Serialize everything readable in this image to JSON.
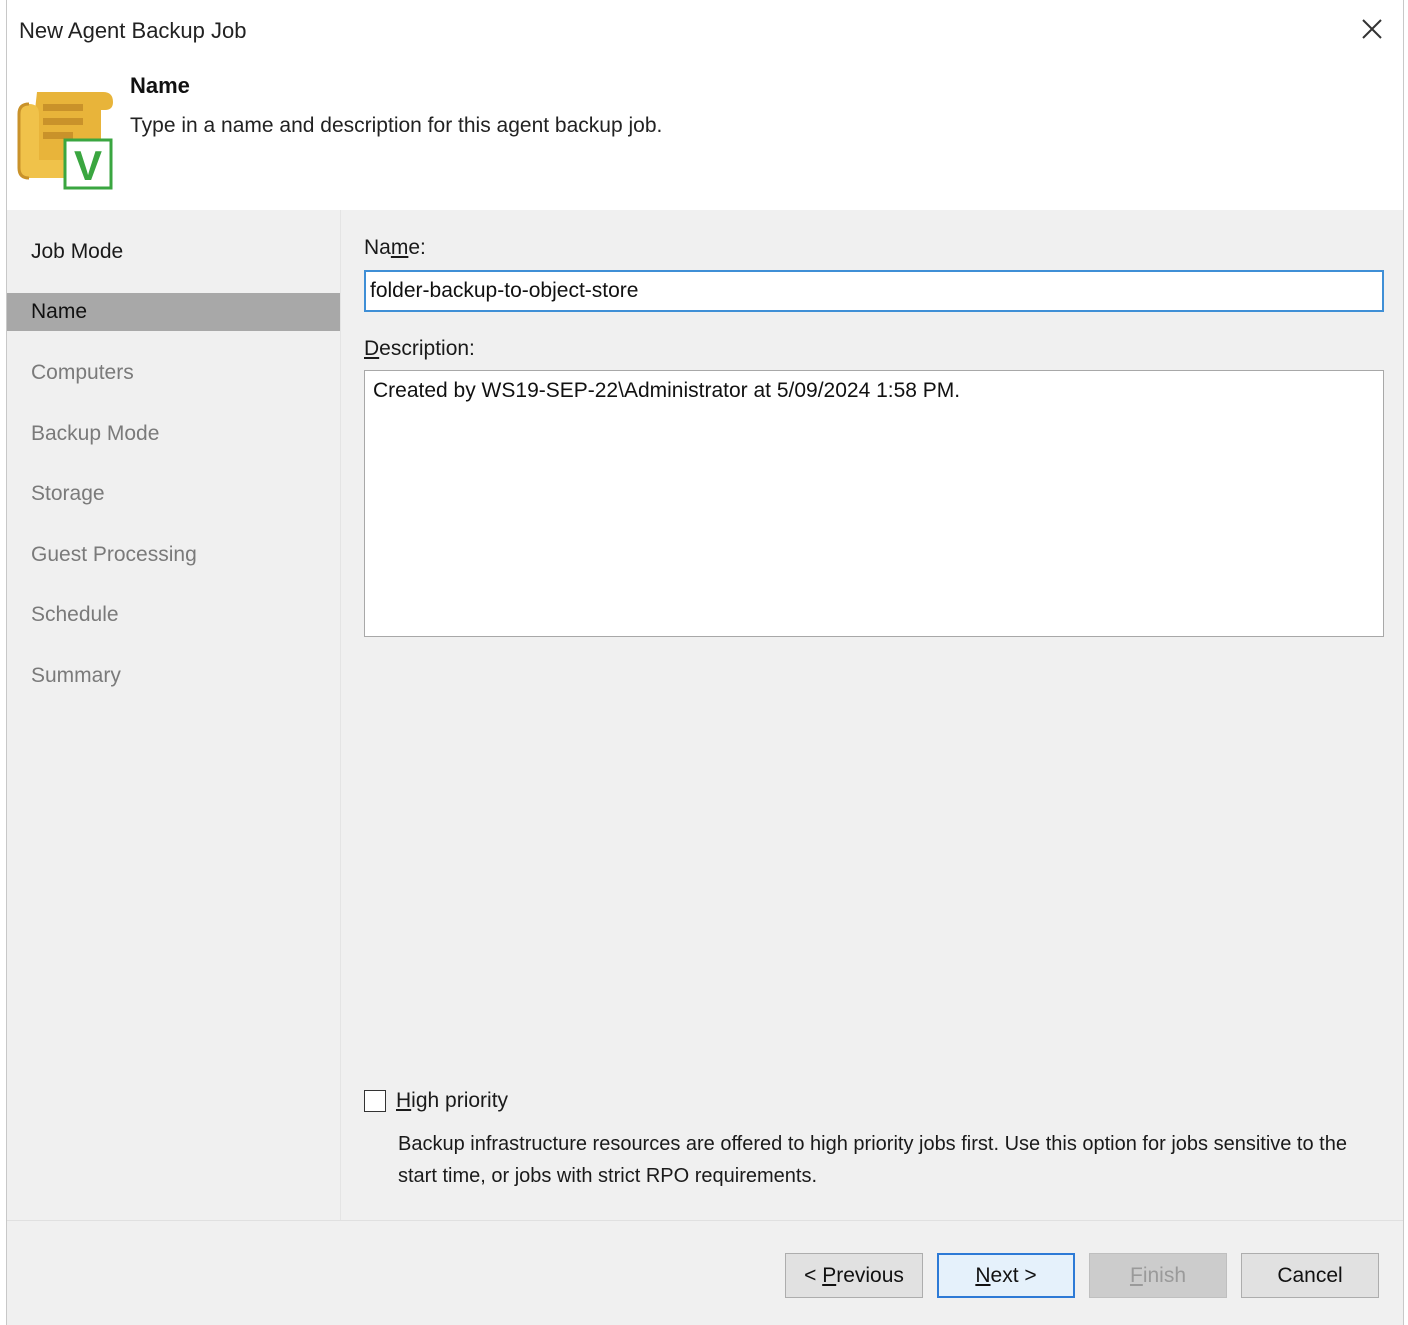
{
  "window": {
    "title": "New Agent Backup Job"
  },
  "header": {
    "title": "Name",
    "subtitle": "Type in a name and description for this agent backup job.",
    "icon_letter": "V"
  },
  "nav": {
    "items": [
      {
        "label": "Job Mode",
        "state": "done"
      },
      {
        "label": "Name",
        "state": "active"
      },
      {
        "label": "Computers",
        "state": "pending"
      },
      {
        "label": "Backup Mode",
        "state": "pending"
      },
      {
        "label": "Storage",
        "state": "pending"
      },
      {
        "label": "Guest Processing",
        "state": "pending"
      },
      {
        "label": "Schedule",
        "state": "pending"
      },
      {
        "label": "Summary",
        "state": "pending"
      }
    ]
  },
  "form": {
    "name_label_pre": "Na",
    "name_label_accel": "m",
    "name_label_post": "e:",
    "name_value": "folder-backup-to-object-store",
    "description_label_accel": "D",
    "description_label_post": "escription:",
    "description_value": "Created by WS19-SEP-22\\Administrator at 5/09/2024 1:58 PM.",
    "high_priority_accel": "H",
    "high_priority_post": "igh priority",
    "high_priority_checked": false,
    "high_priority_hint": "Backup infrastructure resources are offered to high priority jobs first. Use this option for jobs sensitive to the start time, or jobs with strict RPO requirements."
  },
  "buttons": {
    "previous_pre": "< ",
    "previous_accel": "P",
    "previous_post": "revious",
    "next_accel": "N",
    "next_post": "ext >",
    "finish_accel": "F",
    "finish_post": "inish",
    "cancel": "Cancel"
  },
  "colors": {
    "accent": "#3f8fd6",
    "nav_active_bg": "#a8a8a8",
    "icon_scroll": "#e8b43a",
    "icon_check": "#3aa640"
  },
  "icons": {
    "close": "close-icon",
    "header": "veeam-job-scroll-icon"
  }
}
